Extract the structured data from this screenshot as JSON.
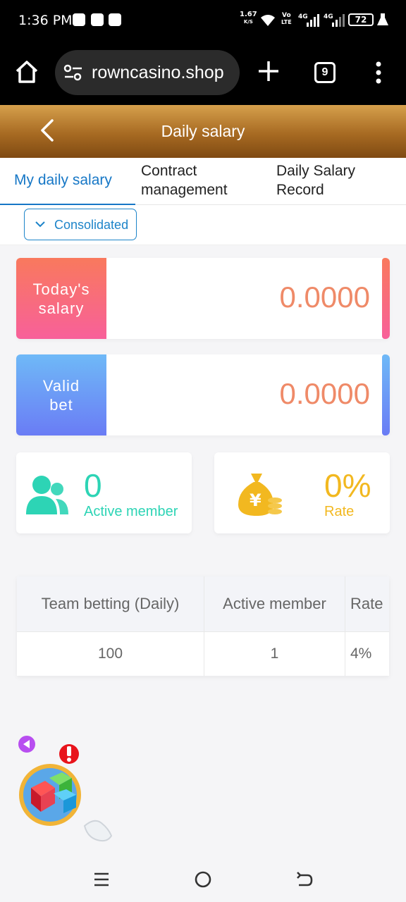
{
  "status_bar": {
    "time": "1:36 PM",
    "net_speed_value": "1.67",
    "net_speed_unit": "K/S",
    "volte_top": "Vo",
    "volte_bottom": "LTE",
    "sig1_label": "4G",
    "sig2_label": "4G",
    "battery": "72"
  },
  "browser": {
    "url": "rowncasino.shop",
    "tab_count": "9"
  },
  "header": {
    "title": "Daily salary"
  },
  "tabs": [
    {
      "label": "My daily salary",
      "active": true
    },
    {
      "label_line1": "Contract",
      "label_line2": "management"
    },
    {
      "label_line1": "Daily Salary",
      "label_line2": "Record"
    }
  ],
  "filter": {
    "label": "Consolidated"
  },
  "cards": {
    "today_salary": {
      "label_line1": "Today's",
      "label_line2": "salary",
      "value": "0.0000"
    },
    "valid_bet": {
      "label_line1": "Valid",
      "label_line2": "bet",
      "value": "0.0000"
    }
  },
  "mini_stats": {
    "active_member": {
      "value": "0",
      "caption": "Active member"
    },
    "rate": {
      "value": "0%",
      "caption": "Rate"
    }
  },
  "table": {
    "headers": [
      "Team betting (Daily)",
      "Active member",
      "Rate"
    ],
    "rows": [
      [
        "100",
        "1",
        "4%"
      ]
    ]
  },
  "colors": {
    "accent_blue": "#1677c6",
    "header_gold": "#a76a22",
    "value_orange": "#ef8a68",
    "teal": "#2dd4b5",
    "gold": "#f2b820"
  }
}
